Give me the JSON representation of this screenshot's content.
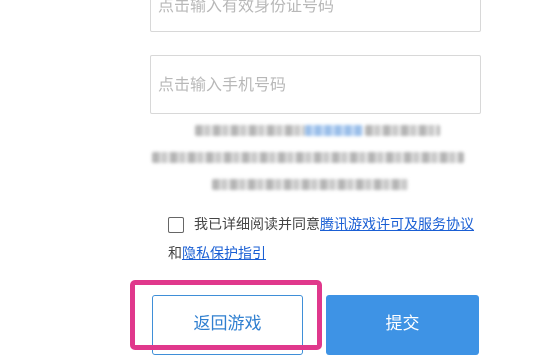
{
  "form": {
    "id_placeholder": "点击输入有效身份证号码",
    "phone_placeholder": "点击输入手机号码"
  },
  "agreement": {
    "prefix": "我已详细阅读并同意",
    "terms_link": "腾讯游戏许可及服务协议",
    "conjunction": "和",
    "privacy_link": "隐私保护指引",
    "checked": false
  },
  "buttons": {
    "back_label": "返回游戏",
    "submit_label": "提交"
  },
  "colors": {
    "highlight": "#e0388c",
    "primary": "#3e93e5",
    "link": "#1a5fd4"
  }
}
